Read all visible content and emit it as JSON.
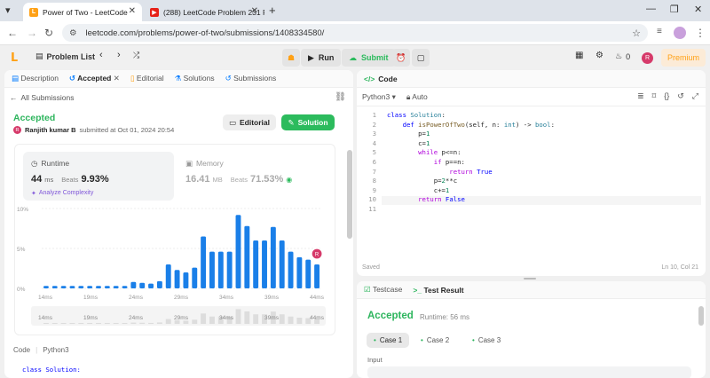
{
  "browser": {
    "tabs": [
      {
        "title": "Power of Two - LeetCode"
      },
      {
        "title": "(288) LeetCode Problem 231 P"
      }
    ],
    "url": "leetcode.com/problems/power-of-two/submissions/1408334580/"
  },
  "toolbar": {
    "problem_list": "Problem List",
    "run": "Run",
    "submit": "Submit",
    "notif_count": "0",
    "avatar": "R",
    "premium": "Premium"
  },
  "left_tabs": [
    "Description",
    "Accepted",
    "Editorial",
    "Solutions",
    "Submissions"
  ],
  "all_submissions": "All Submissions",
  "result": {
    "status": "Accepted",
    "avatar": "R",
    "user": "Ranjith kumar B",
    "submitted": "submitted at Oct 01, 2024 20:54",
    "editorial_btn": "Editorial",
    "solution_btn": "Solution",
    "runtime_label": "Runtime",
    "runtime_value": "44",
    "runtime_unit": "ms",
    "beats_label": "Beats",
    "runtime_beats": "9.93%",
    "analyze": "Analyze Complexity",
    "memory_label": "Memory",
    "memory_value": "16.41",
    "memory_unit": "MB",
    "memory_beats": "71.53%"
  },
  "chart_data": {
    "type": "bar",
    "y_ticks": [
      "10%",
      "5%",
      "0%"
    ],
    "x_ticks": [
      "14ms",
      "19ms",
      "24ms",
      "29ms",
      "34ms",
      "39ms",
      "44ms"
    ],
    "ylim": [
      0,
      10
    ],
    "values": [
      0.3,
      0.3,
      0.3,
      0.3,
      0.3,
      0.3,
      0.3,
      0.3,
      0.3,
      0.3,
      0.8,
      0.7,
      0.6,
      0.9,
      3,
      2.3,
      2,
      2.6,
      6.5,
      4.6,
      4.6,
      4.6,
      9.2,
      7.8,
      6,
      6,
      7.7,
      6,
      4.6,
      3.9,
      3.6,
      3
    ],
    "marker_index": 31,
    "marker_label": "R"
  },
  "code_footer": {
    "label": "Code",
    "lang": "Python3",
    "first_line": "class Solution:"
  },
  "editor": {
    "title": "Code",
    "lang": "Python3",
    "auto": "Auto",
    "saved": "Saved",
    "cursor": "Ln 10, Col 21",
    "line_numbers": [
      "1",
      "2",
      "3",
      "4",
      "5",
      "6",
      "7",
      "8",
      "9",
      "10",
      "11"
    ]
  },
  "testpanel": {
    "tab_testcase": "Testcase",
    "tab_result": "Test Result",
    "status": "Accepted",
    "runtime": "Runtime: 56 ms",
    "cases": [
      "Case 1",
      "Case 2",
      "Case 3"
    ],
    "input_label": "Input"
  }
}
